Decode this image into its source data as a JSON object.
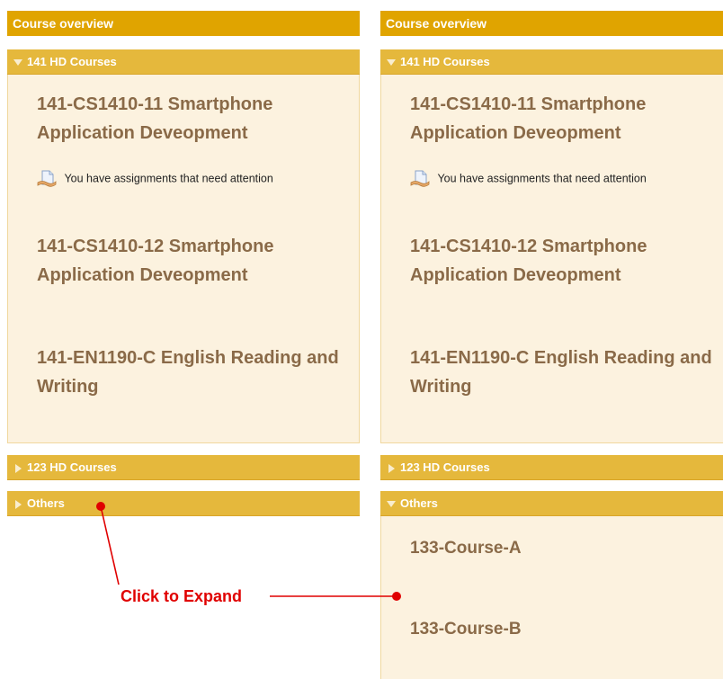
{
  "left": {
    "block_title": "Course overview",
    "groups": [
      {
        "label": "141 HD Courses",
        "state": "expanded"
      },
      {
        "label": "123 HD Courses",
        "state": "collapsed"
      },
      {
        "label": "Others",
        "state": "collapsed"
      }
    ],
    "courses": [
      {
        "title": "141-CS1410-11 Smartphone Application Deveopment",
        "notice": "You have assignments that need attention"
      },
      {
        "title": "141-CS1410-12 Smartphone Application Deveopment"
      },
      {
        "title": "141-EN1190-C English Reading and Writing"
      }
    ]
  },
  "right": {
    "block_title": "Course overview",
    "groups": [
      {
        "label": "141 HD Courses",
        "state": "expanded"
      },
      {
        "label": "123 HD Courses",
        "state": "collapsed"
      },
      {
        "label": "Others",
        "state": "expanded"
      }
    ],
    "courses": [
      {
        "title": "141-CS1410-11 Smartphone Application Deveopment",
        "notice": "You have assignments that need attention"
      },
      {
        "title": "141-CS1410-12 Smartphone Application Deveopment"
      },
      {
        "title": "141-EN1190-C English Reading and Writing"
      }
    ],
    "other_courses": [
      {
        "title": "133-Course-A"
      },
      {
        "title": "133-Course-B"
      }
    ]
  },
  "annotation": {
    "text": "Click to Expand",
    "color": "#e00000"
  },
  "colors": {
    "block_header": "#e0a400",
    "group_header": "#e5b83c",
    "panel_bg": "#fcf2df",
    "course_text": "#8a6a48"
  },
  "icons": {
    "expanded": "triangle-down-icon",
    "collapsed": "triangle-right-icon",
    "assignment": "assignment-icon"
  }
}
